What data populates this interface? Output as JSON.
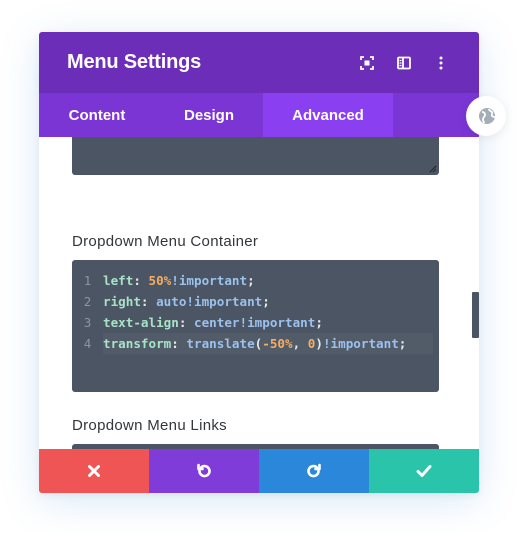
{
  "header": {
    "title": "Menu Settings",
    "icons": [
      "fullscreen-icon",
      "sidebar-toggle-icon",
      "more-vertical-icon"
    ]
  },
  "tabs": [
    {
      "label": "Content",
      "active": false
    },
    {
      "label": "Design",
      "active": false
    },
    {
      "label": "Advanced",
      "active": true
    }
  ],
  "fields": {
    "container": {
      "label": "Dropdown Menu Container",
      "lines": [
        {
          "num": "1",
          "prop": "left",
          "colon": ": ",
          "parts": [
            {
              "t": "n",
              "v": "50%"
            },
            {
              "t": "v",
              "v": "!important"
            },
            {
              "t": "p",
              "v": ";"
            }
          ]
        },
        {
          "num": "2",
          "prop": "right",
          "colon": ": ",
          "parts": [
            {
              "t": "v",
              "v": "auto!important"
            },
            {
              "t": "p",
              "v": ";"
            }
          ]
        },
        {
          "num": "3",
          "prop": "text-align",
          "colon": ": ",
          "parts": [
            {
              "t": "v",
              "v": "center!important"
            },
            {
              "t": "p",
              "v": ";"
            }
          ]
        },
        {
          "num": "4",
          "prop": "transform",
          "colon": ": ",
          "parts": [
            {
              "t": "v",
              "v": "translate"
            },
            {
              "t": "p",
              "v": "("
            },
            {
              "t": "n",
              "v": "-50%"
            },
            {
              "t": "p",
              "v": ", "
            },
            {
              "t": "n",
              "v": "0"
            },
            {
              "t": "p",
              "v": ")"
            },
            {
              "t": "v",
              "v": "!important"
            },
            {
              "t": "p",
              "v": ";"
            }
          ]
        }
      ],
      "active_line": 4
    },
    "links": {
      "label": "Dropdown Menu Links"
    }
  },
  "footer": {
    "buttons": [
      "close-icon",
      "undo-icon",
      "redo-icon",
      "check-icon"
    ]
  },
  "colors": {
    "header": "#6c2eb9",
    "tabs": "#7b35d5",
    "active_tab": "#8a3ff0",
    "cancel": "#ef5555",
    "undo": "#7f3cd8",
    "redo": "#2b87da",
    "save": "#29c4a9"
  }
}
